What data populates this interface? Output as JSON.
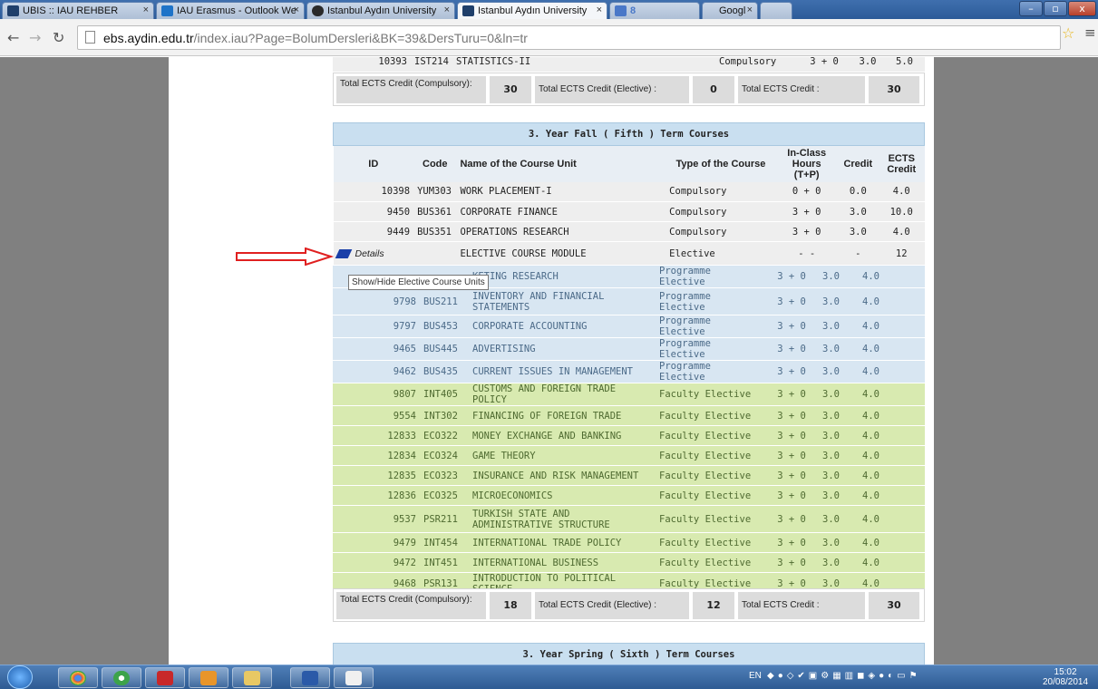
{
  "browser": {
    "tabs": [
      {
        "title": "UBIS :: IAU REHBER",
        "active": false
      },
      {
        "title": "IAU Erasmus - Outlook We",
        "active": false
      },
      {
        "title": "Istanbul Aydın University",
        "active": false
      },
      {
        "title": "Istanbul Aydın University",
        "active": true
      },
      {
        "title": "8",
        "active": false
      },
      {
        "title": "Googl",
        "active": false
      }
    ],
    "url_host": "ebs.aydin.edu.tr",
    "url_path": "/index.iau?Page=BolumDersleri&BK=39&DersTuru=0&ln=tr"
  },
  "prev_row": {
    "id": "10393",
    "code": "IST214",
    "name": "STATISTICS-II",
    "type": "Compulsory",
    "hours": "3 + 0",
    "credit": "3.0",
    "ects": "5.0"
  },
  "prev_totals": {
    "compulsory_label": "Total ECTS Credit (Compulsory):",
    "compulsory_value": "30",
    "elective_label": "Total ECTS Credit (Elective) :",
    "elective_value": "0",
    "total_label": "Total ECTS Credit :",
    "total_value": "30"
  },
  "section": {
    "title": "3. Year Fall ( Fifth ) Term Courses",
    "columns": [
      "ID",
      "Code",
      "Name of the Course Unit",
      "Type of the Course",
      "In-Class Hours (T+P)",
      "Credit",
      "ECTS Credit"
    ],
    "main_rows": [
      {
        "id": "10398",
        "code": "YUM303",
        "name": "WORK PLACEMENT-I",
        "type": "Compulsory",
        "hours": "0 + 0",
        "credit": "0.0",
        "ects": "4.0"
      },
      {
        "id": "9450",
        "code": "BUS361",
        "name": "CORPORATE FINANCE",
        "type": "Compulsory",
        "hours": "3 + 0",
        "credit": "3.0",
        "ects": "10.0"
      },
      {
        "id": "9449",
        "code": "BUS351",
        "name": "OPERATIONS RESEARCH",
        "type": "Compulsory",
        "hours": "3 + 0",
        "credit": "3.0",
        "ects": "4.0"
      }
    ],
    "elective_row": {
      "details_label": "Details",
      "name": "ELECTIVE COURSE MODULE",
      "type": "Elective",
      "hours": "- -",
      "credit": "-",
      "ects": "12"
    },
    "tooltip": "Show/Hide Elective Course Units",
    "programme_rows": [
      {
        "id": "",
        "code": "",
        "name": "KETING RESEARCH",
        "type": "Programme Elective",
        "hours": "3 + 0",
        "credit": "3.0",
        "ects": "4.0"
      },
      {
        "id": "9798",
        "code": "BUS211",
        "name": "INVENTORY AND FINANCIAL STATEMENTS",
        "type": "Programme Elective",
        "hours": "3 + 0",
        "credit": "3.0",
        "ects": "4.0"
      },
      {
        "id": "9797",
        "code": "BUS453",
        "name": "CORPORATE ACCOUNTING",
        "type": "Programme Elective",
        "hours": "3 + 0",
        "credit": "3.0",
        "ects": "4.0"
      },
      {
        "id": "9465",
        "code": "BUS445",
        "name": "ADVERTISING",
        "type": "Programme Elective",
        "hours": "3 + 0",
        "credit": "3.0",
        "ects": "4.0"
      },
      {
        "id": "9462",
        "code": "BUS435",
        "name": "CURRENT ISSUES IN MANAGEMENT",
        "type": "Programme Elective",
        "hours": "3 + 0",
        "credit": "3.0",
        "ects": "4.0"
      }
    ],
    "faculty_rows": [
      {
        "id": "9807",
        "code": "INT405",
        "name": "CUSTOMS AND FOREIGN TRADE POLICY",
        "type": "Faculty Elective",
        "hours": "3 + 0",
        "credit": "3.0",
        "ects": "4.0"
      },
      {
        "id": "9554",
        "code": "INT302",
        "name": "FINANCING OF FOREIGN TRADE",
        "type": "Faculty Elective",
        "hours": "3 + 0",
        "credit": "3.0",
        "ects": "4.0"
      },
      {
        "id": "12833",
        "code": "ECO322",
        "name": "MONEY EXCHANGE AND BANKING",
        "type": "Faculty Elective",
        "hours": "3 + 0",
        "credit": "3.0",
        "ects": "4.0"
      },
      {
        "id": "12834",
        "code": "ECO324",
        "name": "GAME THEORY",
        "type": "Faculty Elective",
        "hours": "3 + 0",
        "credit": "3.0",
        "ects": "4.0"
      },
      {
        "id": "12835",
        "code": "ECO323",
        "name": "INSURANCE AND RISK MANAGEMENT",
        "type": "Faculty Elective",
        "hours": "3 + 0",
        "credit": "3.0",
        "ects": "4.0"
      },
      {
        "id": "12836",
        "code": "ECO325",
        "name": "MICROECONOMICS",
        "type": "Faculty Elective",
        "hours": "3 + 0",
        "credit": "3.0",
        "ects": "4.0"
      },
      {
        "id": "9537",
        "code": "PSR211",
        "name": "TURKISH STATE AND ADMINISTRATIVE STRUCTURE",
        "type": "Faculty Elective",
        "hours": "3 + 0",
        "credit": "3.0",
        "ects": "4.0"
      },
      {
        "id": "9479",
        "code": "INT454",
        "name": "INTERNATIONAL TRADE POLICY",
        "type": "Faculty Elective",
        "hours": "3 + 0",
        "credit": "3.0",
        "ects": "4.0"
      },
      {
        "id": "9472",
        "code": "INT451",
        "name": "INTERNATIONAL BUSINESS",
        "type": "Faculty Elective",
        "hours": "3 + 0",
        "credit": "3.0",
        "ects": "4.0"
      },
      {
        "id": "9468",
        "code": "PSR131",
        "name": "INTRODUCTION TO POLITICAL SCIENCE",
        "type": "Faculty Elective",
        "hours": "3 + 0",
        "credit": "3.0",
        "ects": "4.0"
      }
    ],
    "totals": {
      "compulsory_label": "Total ECTS Credit (Compulsory):",
      "compulsory_value": "18",
      "elective_label": "Total ECTS Credit (Elective) :",
      "elective_value": "12",
      "total_label": "Total ECTS Credit :",
      "total_value": "30"
    }
  },
  "next_section": {
    "title": "3. Year Spring ( Sixth ) Term Courses"
  },
  "taskbar": {
    "tray_lang": "EN",
    "clock_time": "15:02",
    "clock_date": "20/08/2014"
  },
  "colors": {
    "programme_elective_bg": "#d8e6f2",
    "faculty_elective_bg": "#d8eab0",
    "section_header_bg": "#c9dff0",
    "arrow_color": "#e02020"
  }
}
